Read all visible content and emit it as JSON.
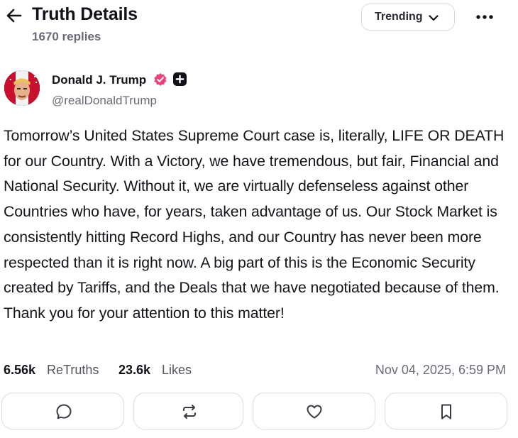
{
  "header": {
    "title": "Truth Details",
    "replies": "1670 replies",
    "sort_label": "Trending",
    "back_icon": "arrow-left-icon",
    "more_icon": "more-horizontal-icon",
    "chevron_icon": "chevron-down-icon"
  },
  "author": {
    "name": "Donald J. Trump",
    "handle": "@realDonaldTrump",
    "verified_badge_color": "#e8447a",
    "plus_badge_color": "#111118"
  },
  "post": {
    "text": "Tomorrow’s United States Supreme Court case is, literally, LIFE OR DEATH for our Country. With a Victory, we have tremendous, but fair, Financial and National Security. Without it, we are virtually defenseless against other Countries who have, for years, taken advantage of us. Our Stock Market is consistently hitting Record Highs, and our Country has never been more respected than it is right now. A big part of this is the Economic Security created by Tariffs, and the Deals that we have negotiated because of them. Thank you for your attention to this matter!",
    "retruths_count": "6.56k",
    "retruths_label": "ReTruths",
    "likes_count": "23.6k",
    "likes_label": "Likes",
    "timestamp": "Nov 04, 2025, 6:59 PM"
  },
  "actions": [
    {
      "name": "reply",
      "icon": "comment-icon"
    },
    {
      "name": "retruth",
      "icon": "retruth-icon"
    },
    {
      "name": "like",
      "icon": "heart-icon"
    },
    {
      "name": "bookmark",
      "icon": "bookmark-icon"
    }
  ]
}
